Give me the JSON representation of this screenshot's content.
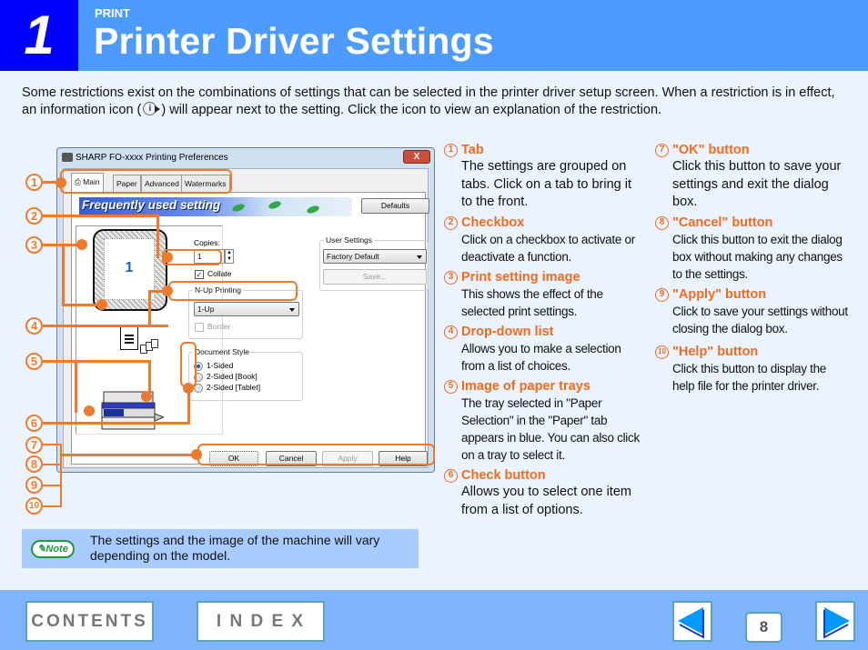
{
  "header": {
    "chapter_number": "1",
    "section": "PRINT",
    "title": "Printer Driver Settings"
  },
  "intro": {
    "text_before_icon": "Some restrictions exist on the combinations of settings that can be selected in the printer driver setup screen. When a restriction is in effect, an information icon (",
    "icon": "info-icon",
    "text_after_icon": ") will appear next to the setting. Click the icon to view an explanation of the restriction."
  },
  "dialog": {
    "title": "SHARP FO-xxxx Printing Preferences",
    "close_label": "X",
    "tabs": [
      "Main",
      "Paper",
      "Advanced",
      "Watermarks"
    ],
    "active_tab": "Main",
    "banner": "Frequently used setting",
    "defaults_button": "Defaults",
    "preview_page_number": "1",
    "copies_label": "Copies:",
    "copies_value": "1",
    "collate_label": "Collate",
    "collate_checked": true,
    "nup_group": "N-Up Printing",
    "nup_value": "1-Up",
    "border_label": "Border",
    "doc_style_group": "Document Style",
    "doc_style_options": [
      "1-Sided",
      "2-Sided [Book]",
      "2-Sided [Tablet]"
    ],
    "doc_style_selected": "1-Sided",
    "user_settings_group": "User Settings",
    "user_settings_value": "Factory Default",
    "save_button": "Save...",
    "ok_button": "OK",
    "cancel_button": "Cancel",
    "apply_button": "Apply",
    "help_button": "Help"
  },
  "callout_numbers": [
    "1",
    "2",
    "3",
    "4",
    "5",
    "6",
    "7",
    "8",
    "9",
    "10"
  ],
  "descriptions": [
    {
      "num": "1",
      "title": "Tab",
      "text": "The settings are grouped on tabs. Click on a tab to bring it to the front."
    },
    {
      "num": "2",
      "title": "Checkbox",
      "text": "Click on a checkbox to activate or deactivate a function."
    },
    {
      "num": "3",
      "title": "Print setting image",
      "text": "This shows the effect of the selected print settings."
    },
    {
      "num": "4",
      "title": "Drop-down list",
      "text": "Allows you to make a selection from a list of choices."
    },
    {
      "num": "5",
      "title": "Image of paper trays",
      "text": "The tray selected in \"Paper Selection\" in the \"Paper\" tab appears in blue. You can also click on a tray to select it."
    },
    {
      "num": "6",
      "title": "Check button",
      "text": "Allows you to select one item from a list of options."
    },
    {
      "num": "7",
      "title": "\"OK\" button",
      "text": "Click this button to save your settings and exit the dialog box."
    },
    {
      "num": "8",
      "title": "\"Cancel\" button",
      "text": "Click this button to exit the dialog box without making any changes to the settings."
    },
    {
      "num": "9",
      "title": "\"Apply\" button",
      "text": "Click to save your settings without closing the dialog box."
    },
    {
      "num": "10",
      "title": "\"Help\" button",
      "text": "Click this button to display the help file for the printer driver."
    }
  ],
  "note": {
    "badge": "Note",
    "text": "The settings and the image of the machine will vary depending on the model."
  },
  "footer": {
    "contents_label": "CONTENTS",
    "index_label": "I N D E X",
    "page_number": "8",
    "prev_icon": "left-arrow-icon",
    "next_icon": "right-arrow-icon"
  },
  "colors": {
    "chapter_blue": "#0000ff",
    "header_blue": "#4d9bff",
    "accent_orange": "#f26b1d",
    "note_bg": "#a8ccff",
    "footer_bg": "#7fb5ff"
  }
}
